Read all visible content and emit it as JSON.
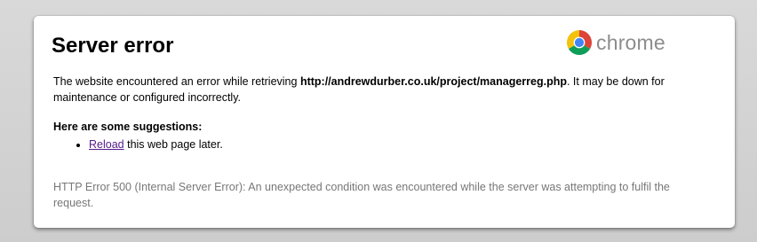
{
  "page": {
    "title": "Server error",
    "brand": "chrome",
    "description": {
      "prefix": "The website encountered an error while retrieving ",
      "url": "http://andrewdurber.co.uk/project/managerreg.php",
      "suffix": ". It may be down for maintenance or configured incorrectly."
    },
    "suggestions_heading": "Here are some suggestions:",
    "suggestions": [
      {
        "link": "Reload",
        "text": " this web page later."
      }
    ],
    "error_detail": "HTTP Error 500 (Internal Server Error): An unexpected condition was encountered while the server was attempting to fulfil the request."
  },
  "colors": {
    "link": "#551a8b",
    "detail_text": "#777777",
    "logo_red": "#db4437",
    "logo_yellow": "#f4c20d",
    "logo_green": "#0f9d58",
    "logo_blue": "#4285f4"
  },
  "icons": {
    "logo": "chrome-logo-icon"
  }
}
